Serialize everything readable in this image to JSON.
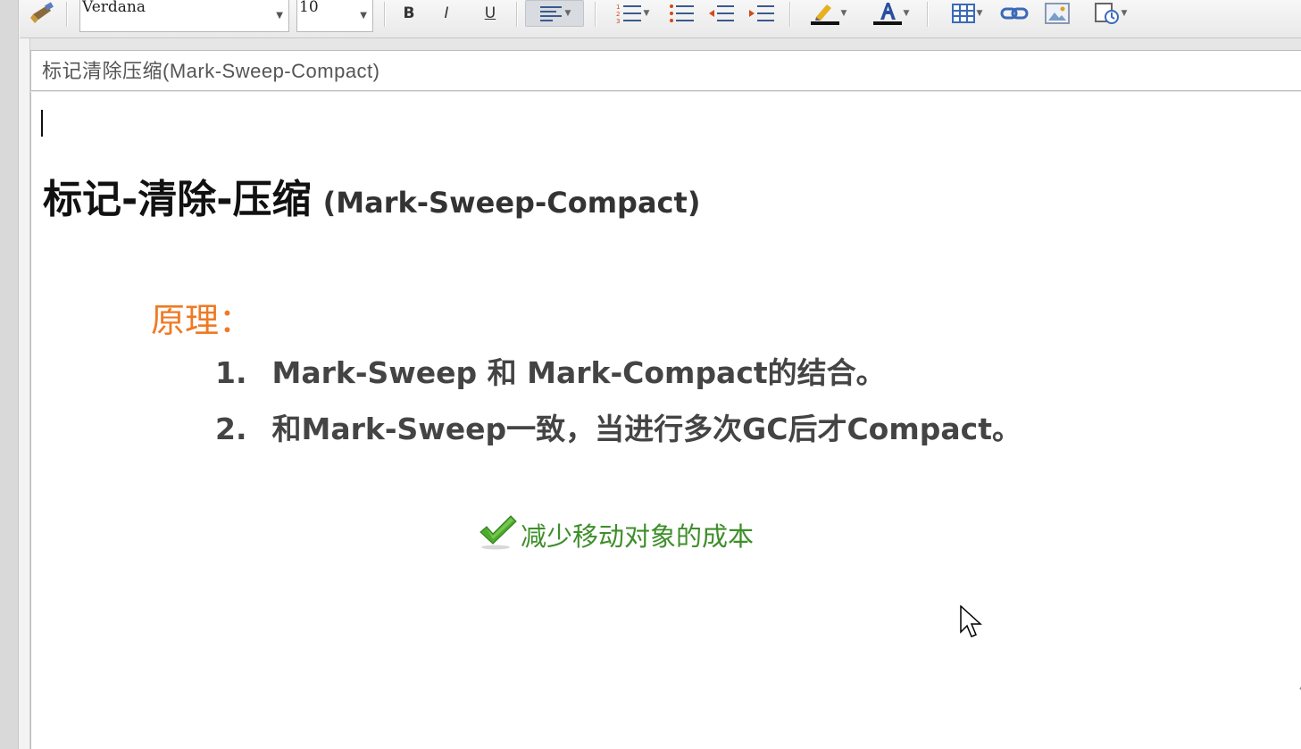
{
  "toolbar": {
    "font_name": "Verdana",
    "font_size": "10",
    "bold_label": "B",
    "italic_label": "I",
    "underline_label": "U",
    "icons": [
      "format-brush-icon",
      "bold-icon",
      "italic-icon",
      "underline-icon",
      "align-left-icon",
      "numbered-list-icon",
      "bullet-list-icon",
      "outdent-icon",
      "indent-icon",
      "highlight-color-icon",
      "font-color-icon",
      "table-icon",
      "link-icon",
      "image-icon",
      "special-icon"
    ]
  },
  "subject": "标记清除压缩(Mark-Sweep-Compact)",
  "content": {
    "heading_cn": "标记-清除-压缩",
    "heading_en": "(Mark-Sweep-Compact)",
    "principle_label": "原理：",
    "items": [
      {
        "num": "1.",
        "text": "Mark-Sweep 和 Mark-Compact的结合。"
      },
      {
        "num": "2.",
        "text": "和Mark-Sweep一致，当进行多次GC后才Compact。"
      }
    ],
    "benefit": "减少移动对象的成本"
  },
  "colors": {
    "principle": "#ef7a24",
    "benefit": "#3e8e2a",
    "heading": "#111111",
    "list": "#444444"
  }
}
